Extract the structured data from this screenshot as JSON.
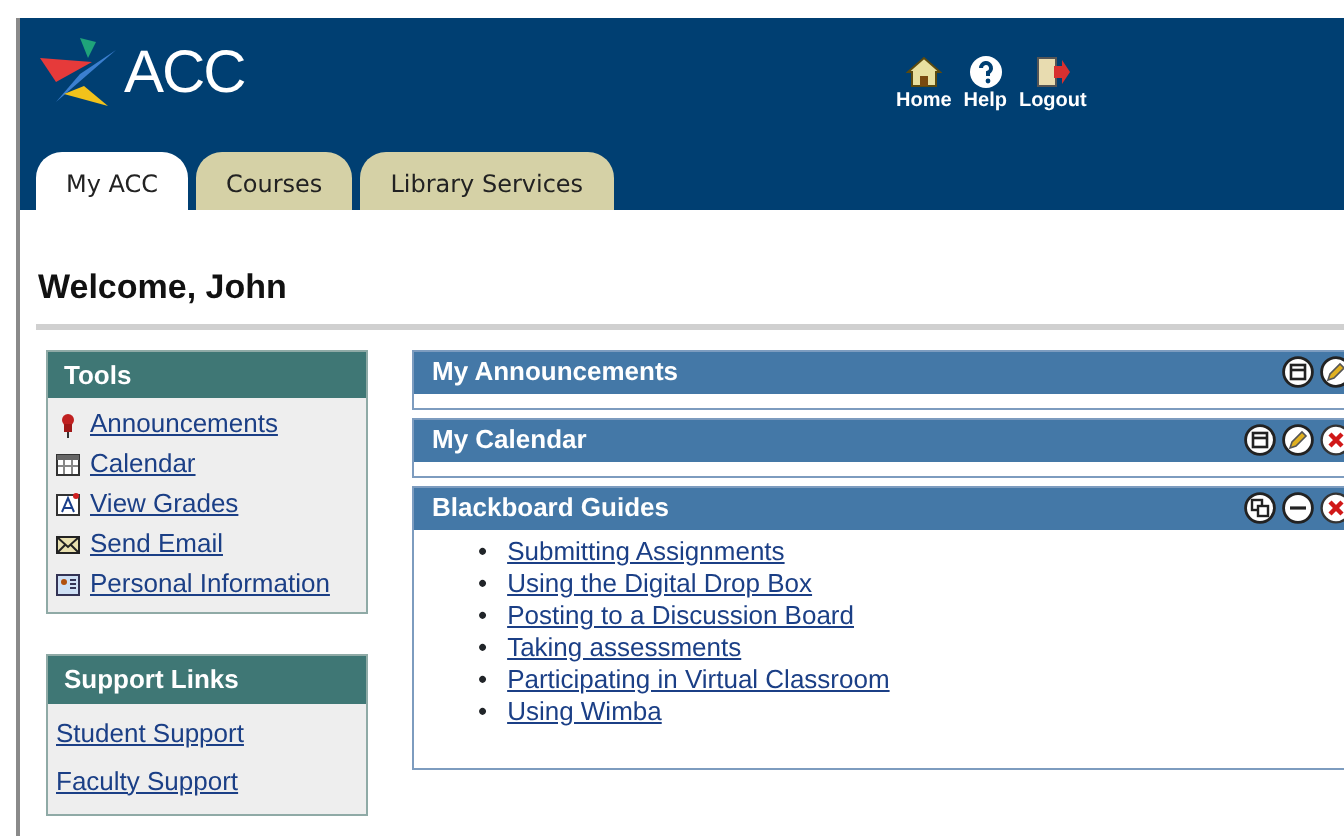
{
  "header": {
    "logo": "ACC",
    "links": [
      {
        "kind": "home",
        "label": "Home"
      },
      {
        "kind": "help",
        "label": "Help"
      },
      {
        "kind": "logout",
        "label": "Logout"
      }
    ]
  },
  "tabs": [
    {
      "label": "My ACC",
      "selected": true
    },
    {
      "label": "Courses",
      "selected": false
    },
    {
      "label": "Library Services",
      "selected": false
    }
  ],
  "welcome": "Welcome, John",
  "tools": {
    "title": "Tools",
    "items": [
      {
        "kind": "pin",
        "label": "Announcements"
      },
      {
        "kind": "calendar",
        "label": "Calendar"
      },
      {
        "kind": "grades",
        "label": "View Grades"
      },
      {
        "kind": "email",
        "label": "Send Email"
      },
      {
        "kind": "card",
        "label": "Personal Information"
      }
    ]
  },
  "support_links": {
    "title": "Support Links",
    "items": [
      "Student Support",
      "Faculty Support"
    ]
  },
  "modules": [
    {
      "title": "My Announcements",
      "actions": [
        {
          "kind": "collapse"
        },
        {
          "kind": "edit"
        }
      ]
    },
    {
      "title": "My Calendar",
      "actions": [
        {
          "kind": "collapse"
        },
        {
          "kind": "edit"
        },
        {
          "kind": "close"
        }
      ]
    },
    {
      "title": "Blackboard Guides",
      "actions": [
        {
          "kind": "restore"
        },
        {
          "kind": "minimize"
        },
        {
          "kind": "close"
        }
      ],
      "links": [
        {
          "bullet": "•",
          "label": "Submitting Assignments"
        },
        {
          "bullet": "•",
          "label": "Using the Digital Drop Box"
        },
        {
          "bullet": "•",
          "label": "Posting to a Discussion Board"
        },
        {
          "bullet": "•",
          "label": "Taking assessments"
        },
        {
          "bullet": "•",
          "label": "Participating in Virtual Classroom"
        },
        {
          "bullet": "•",
          "label": "Using Wimba"
        }
      ]
    }
  ]
}
